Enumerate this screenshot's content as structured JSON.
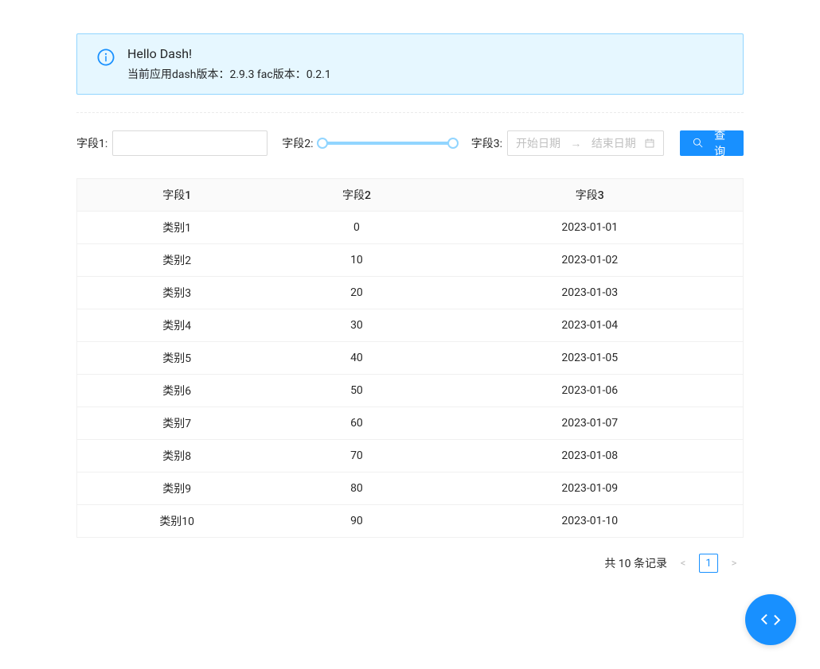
{
  "alert": {
    "title": "Hello Dash!",
    "description": "当前应用dash版本：2.9.3 fac版本：0.2.1"
  },
  "filters": {
    "field1": {
      "label": "字段1:",
      "value": ""
    },
    "field2": {
      "label": "字段2:"
    },
    "field3": {
      "label": "字段3:",
      "placeholder_start": "开始日期",
      "placeholder_end": "结束日期"
    },
    "search_button": "查询"
  },
  "table": {
    "headers": [
      "字段1",
      "字段2",
      "字段3"
    ],
    "rows": [
      [
        "类别1",
        "0",
        "2023-01-01"
      ],
      [
        "类别2",
        "10",
        "2023-01-02"
      ],
      [
        "类别3",
        "20",
        "2023-01-03"
      ],
      [
        "类别4",
        "30",
        "2023-01-04"
      ],
      [
        "类别5",
        "40",
        "2023-01-05"
      ],
      [
        "类别6",
        "50",
        "2023-01-06"
      ],
      [
        "类别7",
        "60",
        "2023-01-07"
      ],
      [
        "类别8",
        "70",
        "2023-01-08"
      ],
      [
        "类别9",
        "80",
        "2023-01-09"
      ],
      [
        "类别10",
        "90",
        "2023-01-10"
      ]
    ]
  },
  "pagination": {
    "total_text": "共 10 条记录",
    "current": "1"
  }
}
